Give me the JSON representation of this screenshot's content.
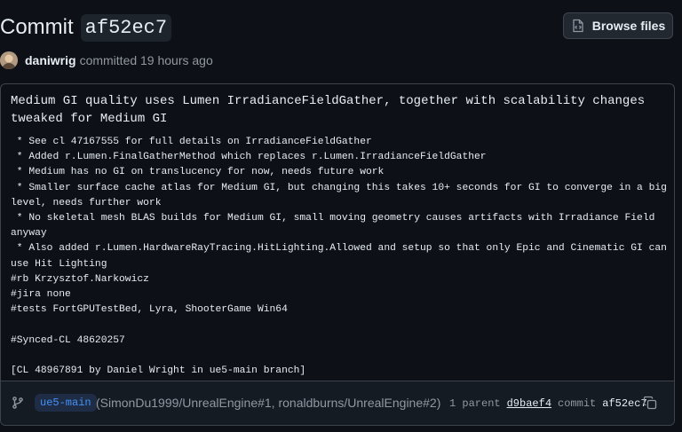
{
  "header": {
    "title_word": "Commit",
    "sha": "af52ec7",
    "browse_label": "Browse files"
  },
  "meta": {
    "author": "daniwrig",
    "committed_text": "committed 19 hours ago"
  },
  "message": {
    "title": "Medium GI quality uses Lumen IrradianceFieldGather, together with scalability changes tweaked for Medium GI",
    "body": " * See cl 47167555 for full details on IrradianceFieldGather\n * Added r.Lumen.FinalGatherMethod which replaces r.Lumen.IrradianceFieldGather\n * Medium has no GI on translucency for now, needs future work\n * Smaller surface cache atlas for Medium GI, but changing this takes 10+ seconds for GI to converge in a big level, needs further work\n * No skeletal mesh BLAS builds for Medium GI, small moving geometry causes artifacts with Irradiance Field anyway\n * Also added r.Lumen.HardwareRayTracing.HitLighting.Allowed and setup so that only Epic and Cinematic GI can use Hit Lighting\n#rb Krzysztof.Narkowicz\n#jira none\n#tests FortGPUTestBed, Lyra, ShooterGame Win64\n\n#Synced-CL 48620257\n\n[CL 48967891 by Daniel Wright in ue5-main branch]"
  },
  "footer": {
    "branch": "ue5-main",
    "pr_refs": "(SimonDu1999/UnrealEngine#1, ronaldburns/UnrealEngine#2)",
    "parent_label": "1 parent",
    "parent_sha": "d9baef4",
    "commit_label": "commit",
    "commit_sha": "af52ec7"
  }
}
